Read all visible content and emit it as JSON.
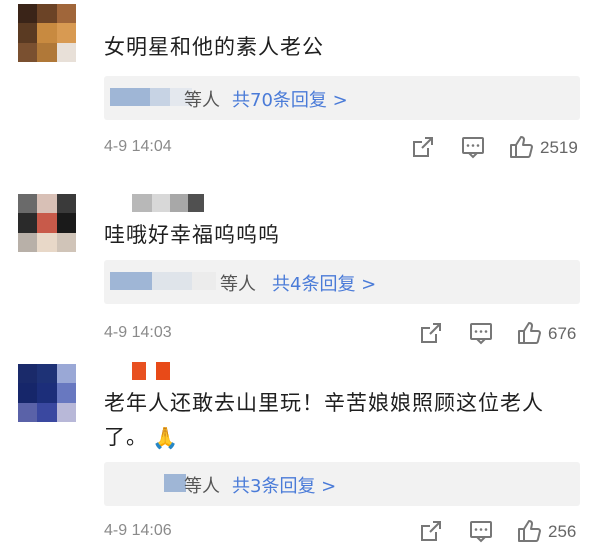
{
  "comments": [
    {
      "text": "女明星和他的素人老公",
      "reply_who": "等人",
      "reply_count": "共70条回复 >",
      "time": "4-9 14:04",
      "likes": "2519"
    },
    {
      "text": "哇哦好幸福呜呜呜",
      "reply_who": "等人",
      "reply_count": "共4条回复 >",
      "time": "4-9 14:03",
      "likes": "676"
    },
    {
      "text": "老年人还敢去山里玩！辛苦娘娘照顾这位老人",
      "text2": "了。",
      "emoji": "🙏",
      "reply_who": "等人",
      "reply_count": "共3条回复 >",
      "time": "4-9 14:06",
      "likes": "256"
    }
  ],
  "icons": {
    "share": "share-icon",
    "comment": "comment-icon",
    "like": "thumbs-up-icon"
  },
  "colors": {
    "link": "#4a7bd8",
    "meta": "#8a8a8a",
    "reply_bg": "#f2f2f2"
  }
}
